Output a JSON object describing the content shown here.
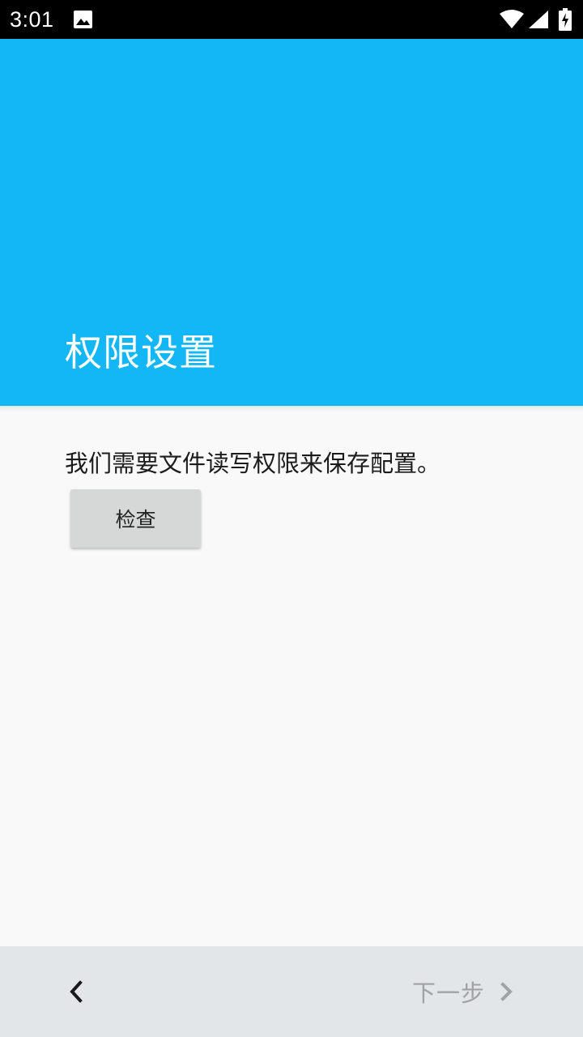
{
  "status_bar": {
    "time": "3:01",
    "icons": [
      "image-notification-icon",
      "wifi-icon",
      "cellular-signal-icon",
      "battery-charging-icon"
    ]
  },
  "header": {
    "title": "权限设置",
    "background_color": "#13b7f6"
  },
  "content": {
    "description": "我们需要文件读写权限来保存配置。",
    "check_button_label": "检查"
  },
  "bottom_bar": {
    "back_icon": "chevron-left-icon",
    "next_label": "下一步",
    "next_icon": "chevron-right-icon",
    "next_enabled": false
  }
}
